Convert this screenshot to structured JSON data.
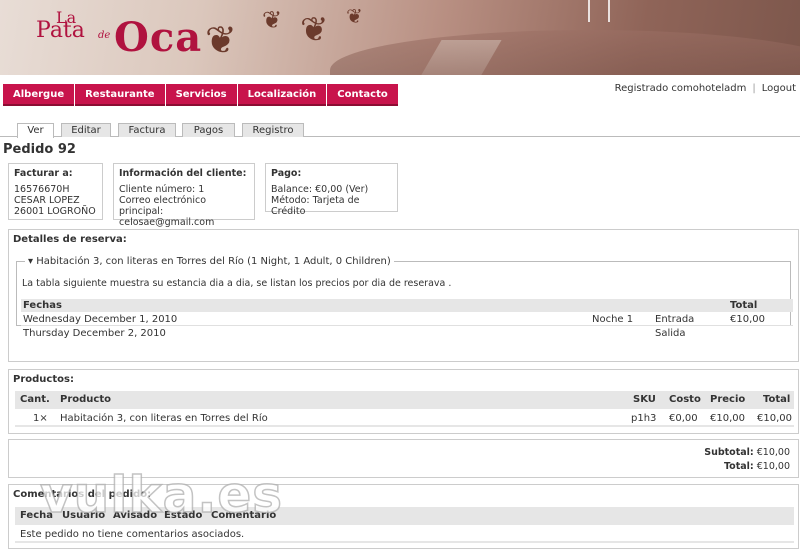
{
  "logo": {
    "la": "La",
    "pata": "Pata",
    "de": "de",
    "oca": "Oca"
  },
  "nav": [
    "Albergue",
    "Restaurante",
    "Servicios",
    "Localización",
    "Contacto"
  ],
  "user": {
    "registered": "Registrado comohoteladm",
    "logout": "Logout"
  },
  "tabs": [
    "Ver",
    "Editar",
    "Factura",
    "Pagos",
    "Registro"
  ],
  "page_title": "Pedido 92",
  "billing": {
    "title": "Facturar a:",
    "lines": [
      "16576670H",
      "CESAR LOPEZ",
      "26001 LOGROÑO"
    ]
  },
  "client": {
    "title": "Información del cliente:",
    "lines": [
      "Cliente número: 1",
      "Correo electrónico principal:",
      "celosae@gmail.com"
    ]
  },
  "payment": {
    "title": "Pago:",
    "lines": [
      "Balance: €0,00 (Ver)",
      "Método: Tarjeta de Crédito"
    ]
  },
  "reservation": {
    "title": "Detalles de reserva:",
    "legend": "Habitación 3, con literas en Torres del Río (1 Night, 1 Adult, 0 Children)",
    "note": "La tabla siguiente muestra su estancia dia a dia, se listan los precios por dia de reserava .",
    "headers": {
      "fechas": "Fechas",
      "total": "Total"
    },
    "rows": [
      {
        "date": "Wednesday December 1, 2010",
        "night": "Noche 1",
        "type": "Entrada",
        "total": "€10,00"
      },
      {
        "date": "Thursday December 2, 2010",
        "night": "",
        "type": "Salida",
        "total": ""
      }
    ]
  },
  "products": {
    "title": "Productos:",
    "headers": {
      "qty": "Cant.",
      "product": "Producto",
      "sku": "SKU",
      "cost": "Costo",
      "price": "Precio",
      "total": "Total"
    },
    "rows": [
      {
        "qty": "1×",
        "product": "Habitación 3, con literas en Torres del Río",
        "sku": "p1h3",
        "cost": "€0,00",
        "price": "€10,00",
        "total": "€10,00"
      }
    ]
  },
  "totals": {
    "subtotal_label": "Subtotal:",
    "subtotal": "€10,00",
    "total_label": "Total:",
    "total": "€10,00"
  },
  "comments": {
    "title": "Comentarios del pedido:",
    "headers": [
      "Fecha",
      "Usuario",
      "Avisado",
      "Estado",
      "Comentario"
    ],
    "empty": "Este pedido no tiene comentarios asociados."
  },
  "watermark": "vulka.es",
  "colors": {
    "nav": "#c8144c",
    "brand": "#b0123f"
  }
}
